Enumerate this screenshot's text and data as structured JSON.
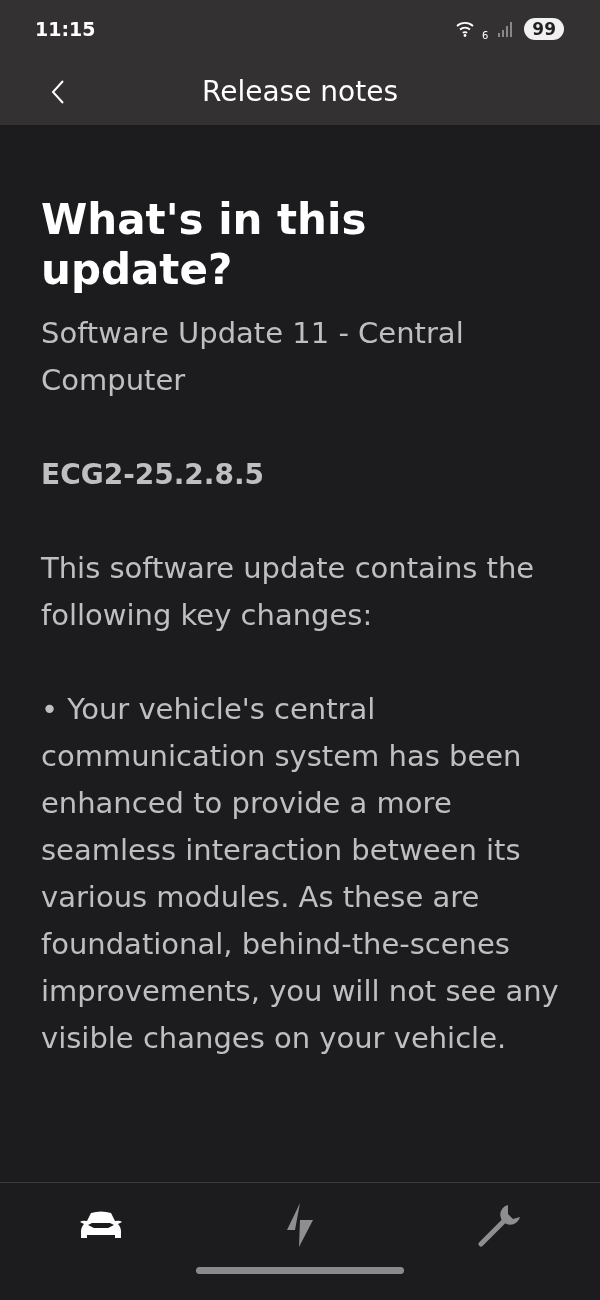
{
  "status_bar": {
    "time": "11:15",
    "wifi_badge": "6",
    "battery": "99"
  },
  "header": {
    "title": "Release notes"
  },
  "content": {
    "heading": "What's in this update?",
    "blocks": [
      {
        "kind": "subtitle",
        "text": "Software Update 11 - Central Computer"
      },
      {
        "kind": "version",
        "text": "ECG2-25.2.8.5"
      },
      {
        "kind": "paragraph",
        "text": "This software update contains the following key changes:"
      },
      {
        "kind": "bullet",
        "marker": "•",
        "text": "Your vehicle's central communication system has been enhanced to provide a more seamless interaction between its various modules. As these are foundational, behind-the-scenes improvements, you will not see any visible changes on your vehicle."
      }
    ]
  },
  "bottom_nav": [
    {
      "kind": "car",
      "selected": true
    },
    {
      "kind": "bolt",
      "selected": false
    },
    {
      "kind": "wrench",
      "selected": false
    }
  ]
}
